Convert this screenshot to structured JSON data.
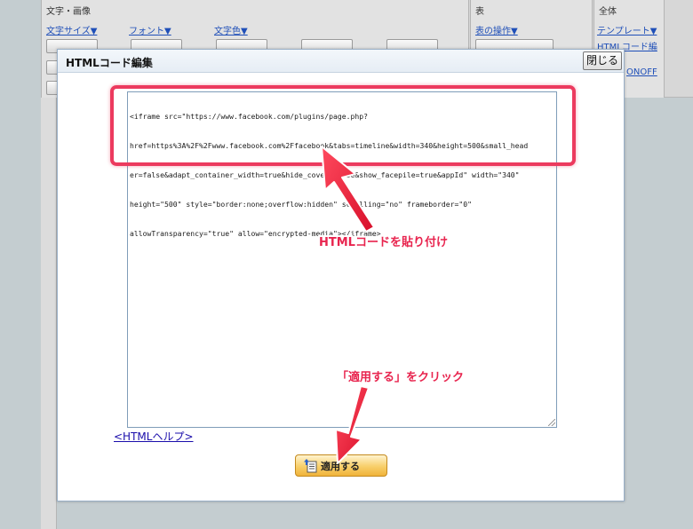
{
  "toolbar": {
    "groups": [
      {
        "title": "文字・画像",
        "links": [
          "文字サイズ▼",
          "フォント▼",
          "文字色▼"
        ]
      },
      {
        "title": "表",
        "links": [
          "表の操作▼"
        ]
      },
      {
        "title": "全体",
        "links": [
          "テンプレート▼",
          "HTMLコード編",
          "ONOFF"
        ]
      }
    ]
  },
  "dialog": {
    "title": "HTMLコード編集",
    "close_label": "閉じる",
    "code_lines": [
      "<iframe src=\"https://www.facebook.com/plugins/page.php?",
      "href=https%3A%2F%2Fwww.facebook.com%2Ffacebook&tabs=timeline&width=340&height=500&small_head",
      "er=false&adapt_container_width=true&hide_cover=false&show_facepile=true&appId\" width=\"340\"",
      "height=\"500\" style=\"border:none;overflow:hidden\" scrolling=\"no\" frameborder=\"0\"",
      "allowTransparency=\"true\" allow=\"encrypted-media\"></iframe>"
    ],
    "help_link": "<HTMLヘルプ>",
    "apply_label": "適用する"
  },
  "annotations": {
    "paste_note": "HTMLコードを貼り付け",
    "click_note": "「適用する」をクリック",
    "color": "#e8244e"
  }
}
